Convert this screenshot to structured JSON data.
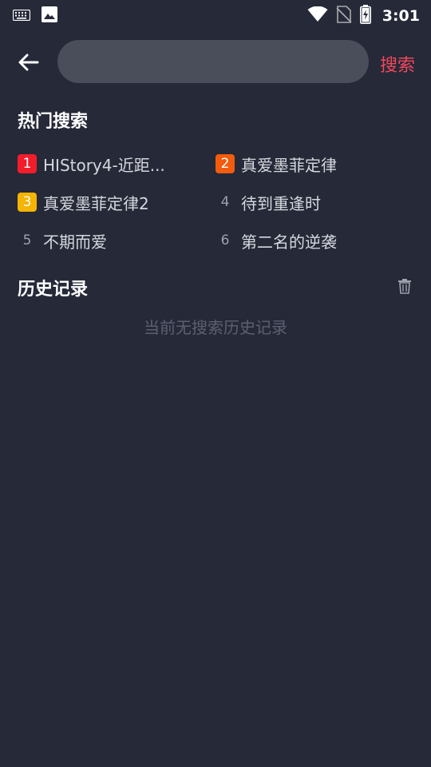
{
  "status_bar": {
    "time": "3:01",
    "icons": [
      "keyboard-icon",
      "image-icon",
      "wifi-icon",
      "no-sim-icon",
      "battery-charging-icon"
    ]
  },
  "top_bar": {
    "back_icon": "arrow-left-icon",
    "search_value": "",
    "search_button_label": "搜索"
  },
  "hot": {
    "title": "热门搜索",
    "items": [
      {
        "rank": "1",
        "text": "HIStory4-近距...",
        "badge_color": "#f21d2b"
      },
      {
        "rank": "2",
        "text": "真爱墨菲定律",
        "badge_color": "#f25c0c"
      },
      {
        "rank": "3",
        "text": "真爱墨菲定律2",
        "badge_color": "#f5b400"
      },
      {
        "rank": "4",
        "text": "待到重逢时",
        "badge_color": ""
      },
      {
        "rank": "5",
        "text": "不期而爱",
        "badge_color": ""
      },
      {
        "rank": "6",
        "text": "第二名的逆袭",
        "badge_color": ""
      }
    ]
  },
  "history": {
    "title": "历史记录",
    "empty_text": "当前无搜索历史记录",
    "clear_icon": "trash-icon"
  },
  "colors": {
    "background": "#252938",
    "accent": "#f2475b",
    "search_field": "#4a4e5a"
  }
}
